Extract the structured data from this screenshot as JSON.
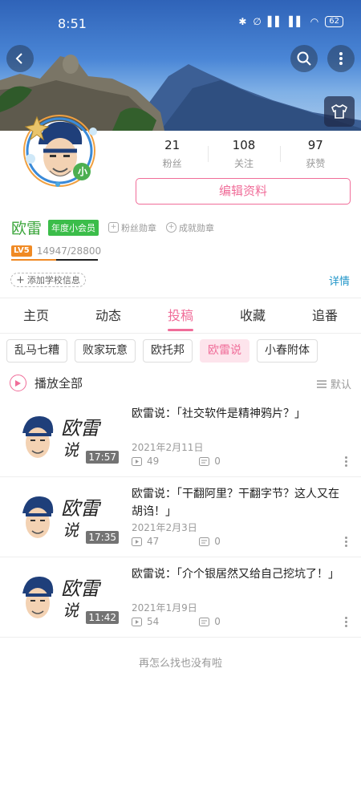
{
  "status_bar": {
    "time": "8:51",
    "battery": "62"
  },
  "profile": {
    "avatar_badge": "小",
    "stats": [
      {
        "value": "21",
        "label": "粉丝"
      },
      {
        "value": "108",
        "label": "关注"
      },
      {
        "value": "97",
        "label": "获赞"
      }
    ],
    "edit_button": "编辑资料",
    "name": "欧雷",
    "vip_badge": "年度小会员",
    "fan_medal": "粉丝勋章",
    "achievement_medal": "成就勋章",
    "level_tag": "LV5",
    "exp_text": "14947/28800",
    "exp_fraction": 0.519,
    "school_button": "添加学校信息",
    "detail_link": "详情"
  },
  "tabs": [
    {
      "label": "主页",
      "active": false
    },
    {
      "label": "动态",
      "active": false
    },
    {
      "label": "投稿",
      "active": true
    },
    {
      "label": "收藏",
      "active": false
    },
    {
      "label": "追番",
      "active": false
    }
  ],
  "chips": [
    {
      "label": "乱马七糟",
      "active": false
    },
    {
      "label": "败家玩意",
      "active": false
    },
    {
      "label": "欧托邦",
      "active": false
    },
    {
      "label": "欧雷说",
      "active": true
    },
    {
      "label": "小春附体",
      "active": false
    }
  ],
  "play_all": {
    "label": "播放全部",
    "sort_label": "默认"
  },
  "videos": [
    {
      "title": "欧雷说：「社交软件是精神鸦片？」",
      "duration": "17:57",
      "date": "2021年2月11日",
      "plays": "49",
      "danmaku": "0"
    },
    {
      "title": "欧雷说：「干翻阿里？干翻字节？这人又在胡诌！」",
      "duration": "17:35",
      "date": "2021年2月3日",
      "plays": "47",
      "danmaku": "0"
    },
    {
      "title": "欧雷说：「介个银居然又给自己挖坑了！」",
      "duration": "11:42",
      "date": "2021年1月9日",
      "plays": "54",
      "danmaku": "0"
    }
  ],
  "thumb_text": {
    "line1": "欧雷",
    "line2": "说"
  },
  "end_text": "再怎么找也没有啦",
  "colors": {
    "accent": "#f06d99",
    "name_green": "#3aa53a",
    "vip_green": "#3bbd4a",
    "level_orange": "#f08a24",
    "link_blue": "#2196c9"
  }
}
